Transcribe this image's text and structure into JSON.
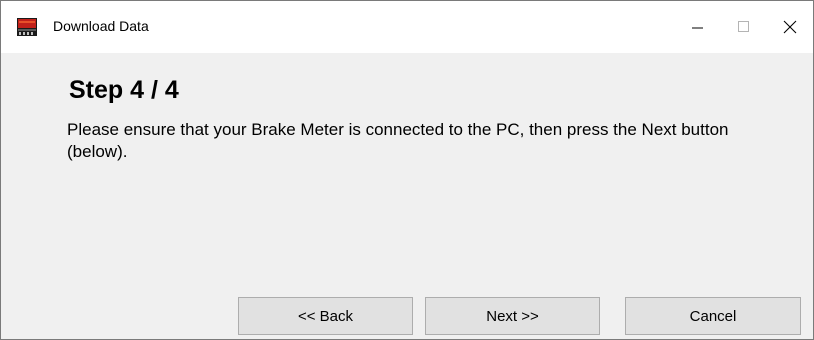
{
  "window": {
    "title": "Download Data",
    "controls": {
      "minimize_icon": "minimize-icon",
      "maximize_icon": "maximize-icon",
      "close_icon": "close-icon"
    }
  },
  "content": {
    "step_title": "Step 4 / 4",
    "instructions": "Please ensure that your Brake Meter is connected to the PC, then press the Next button (below)."
  },
  "buttons": {
    "back_label": "<< Back",
    "next_label": "Next >>",
    "cancel_label": "Cancel"
  },
  "colors": {
    "titlebar_bg": "#ffffff",
    "dialog_bg": "#f0f0f0",
    "button_bg": "#e1e1e1",
    "button_border": "#adadad"
  }
}
